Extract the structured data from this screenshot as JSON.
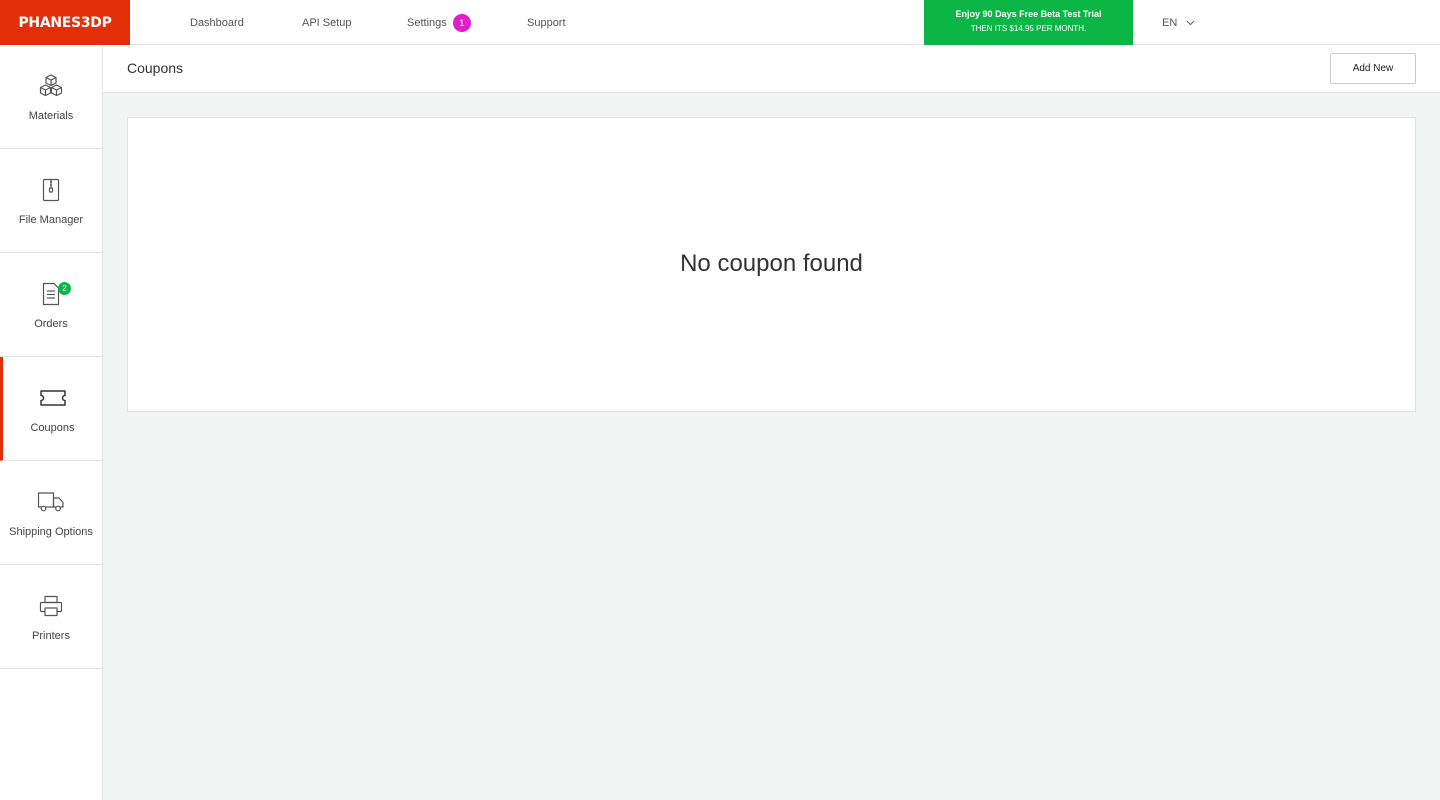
{
  "brand": {
    "logo": "PHANES3DP",
    "accent": "#e32e0a",
    "trial_color": "#0cb646"
  },
  "nav": {
    "dashboard": "Dashboard",
    "api_setup": "API Setup",
    "settings": "Settings",
    "settings_badge": "1",
    "support": "Support"
  },
  "trial": {
    "line1": "Enjoy 90 Days Free Beta Test Trial",
    "line2": "THEN ITS $14.95 PER MONTH."
  },
  "language": {
    "value": "EN",
    "icon": "chevron-down-icon"
  },
  "sidebar": {
    "items": [
      {
        "label": "Materials",
        "icon": "cubes-icon",
        "active": false
      },
      {
        "label": "File Manager",
        "icon": "zip-file-icon",
        "active": false
      },
      {
        "label": "Orders",
        "icon": "document-icon",
        "badge": "2",
        "active": false
      },
      {
        "label": "Coupons",
        "icon": "ticket-icon",
        "active": true
      },
      {
        "label": "Shipping Options",
        "icon": "truck-icon",
        "active": false
      },
      {
        "label": "Printers",
        "icon": "printer-icon",
        "active": false
      }
    ]
  },
  "header": {
    "title": "Coupons",
    "add_label": "Add New"
  },
  "main": {
    "empty_message": "No coupon found"
  }
}
